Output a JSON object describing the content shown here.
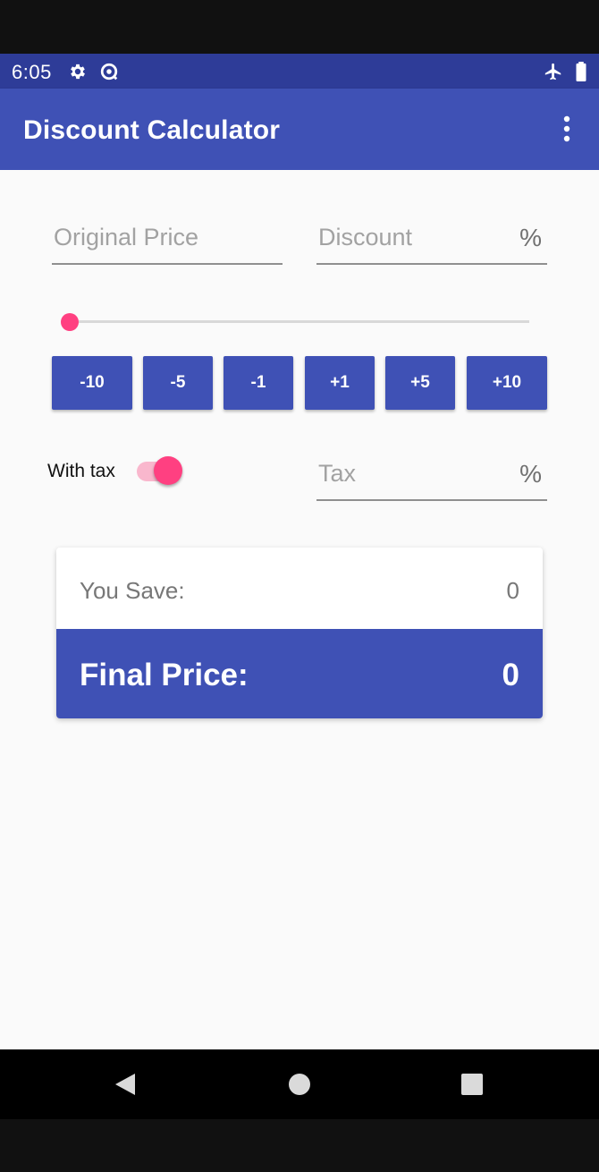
{
  "status_bar": {
    "time": "6:05",
    "icons": [
      "gear-icon",
      "data-saver-icon",
      "airplane-icon",
      "battery-icon"
    ]
  },
  "app_bar": {
    "title": "Discount Calculator",
    "menu_icon": "overflow-menu-icon"
  },
  "inputs": {
    "original_price": {
      "placeholder": "Original Price",
      "value": ""
    },
    "discount": {
      "placeholder": "Discount",
      "value": "",
      "suffix": "%"
    },
    "tax": {
      "placeholder": "Tax",
      "value": "",
      "suffix": "%"
    }
  },
  "slider": {
    "value": 0,
    "min": 0,
    "max": 100
  },
  "step_buttons": [
    "-10",
    "-5",
    "-1",
    "+1",
    "+5",
    "+10"
  ],
  "tax_toggle": {
    "label": "With tax",
    "checked": true
  },
  "result": {
    "save_label": "You Save:",
    "save_value": "0",
    "final_label": "Final Price:",
    "final_value": "0"
  },
  "nav_bar": {
    "icons": [
      "back-icon",
      "home-icon",
      "recents-icon"
    ]
  },
  "colors": {
    "primary": "#3F51B5",
    "primary_dark": "#2E3C98",
    "accent": "#FF4081",
    "background": "#FAFAFA"
  }
}
